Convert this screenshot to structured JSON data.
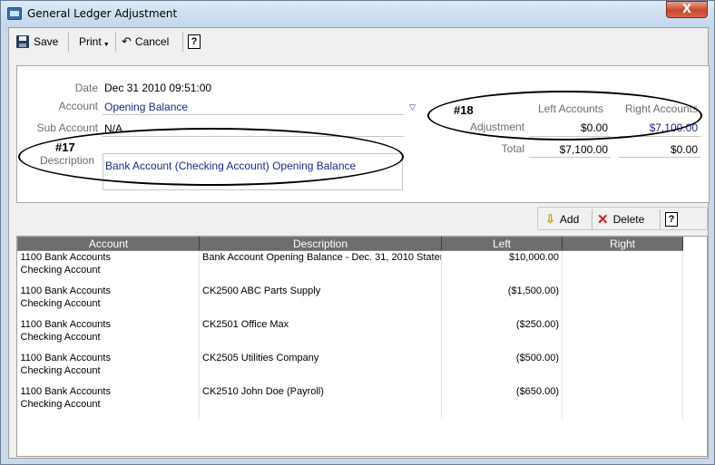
{
  "window": {
    "title": "General Ledger Adjustment",
    "close_label": "X"
  },
  "toolbar": {
    "save_label": "Save",
    "print_label": "Print",
    "cancel_label": "Cancel",
    "help_label": "?"
  },
  "form": {
    "date_label": "Date",
    "date_value": "Dec 31 2010 09:51:00",
    "account_label": "Account",
    "account_value": "Opening Balance",
    "sub_account_label": "Sub Account",
    "sub_account_value": "N/A",
    "description_label": "Description",
    "description_value": "Bank Account (Checking Account) Opening Balance",
    "annotation_17": "#17",
    "annotation_18": "#18",
    "left_accounts_label": "Left Accounts",
    "right_accounts_label": "Right Accounts",
    "adjustment_label": "Adjustment",
    "adjustment_left": "$0.00",
    "adjustment_right": "$7,100.00",
    "total_label": "Total",
    "total_left": "$7,100.00",
    "total_right": "$0.00"
  },
  "grid_toolbar": {
    "add_label": "Add",
    "delete_label": "Delete",
    "help_label": "?"
  },
  "table": {
    "columns": [
      "Account",
      "Description",
      "Left",
      "Right"
    ],
    "rows": [
      {
        "account_line1": "1100 Bank Accounts",
        "account_line2": "Checking Account",
        "description": "Bank Account Opening Balance - Dec. 31, 2010 Stater",
        "left": "$10,000.00",
        "right": ""
      },
      {
        "account_line1": "1100 Bank Accounts",
        "account_line2": "Checking Account",
        "description": "CK2500 ABC Parts Supply",
        "left": "($1,500.00)",
        "right": ""
      },
      {
        "account_line1": "1100 Bank Accounts",
        "account_line2": "Checking Account",
        "description": "CK2501 Office Max",
        "left": "($250.00)",
        "right": ""
      },
      {
        "account_line1": "1100 Bank Accounts",
        "account_line2": "Checking Account",
        "description": "CK2505 Utilities Company",
        "left": "($500.00)",
        "right": ""
      },
      {
        "account_line1": "1100 Bank Accounts",
        "account_line2": "Checking Account",
        "description": "CK2510 John Doe (Payroll)",
        "left": "($650.00)",
        "right": ""
      }
    ]
  },
  "colors": {
    "header_bg": "#6e6e6e",
    "value_text": "#1a2a8a",
    "close_button": "#c9462c"
  }
}
